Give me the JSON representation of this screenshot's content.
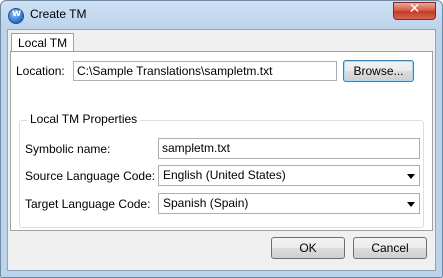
{
  "window": {
    "title": "Create TM",
    "close_glyph": "✕"
  },
  "tab": {
    "label": "Local TM"
  },
  "location": {
    "label": "Location:",
    "value": "C:\\Sample Translations\\sampletm.txt",
    "browse_label": "Browse..."
  },
  "properties": {
    "group_title": "Local TM Properties",
    "symbolic_name": {
      "label": "Symbolic name:",
      "value": "sampletm.txt"
    },
    "source_language": {
      "label": "Source Language Code:",
      "value": "English (United States)"
    },
    "target_language": {
      "label": "Target Language Code:",
      "value": "Spanish (Spain)"
    }
  },
  "footer": {
    "ok_label": "OK",
    "cancel_label": "Cancel"
  },
  "icons": {
    "app": "app-icon",
    "close": "close-icon",
    "dropdown": "chevron-down-icon"
  },
  "colors": {
    "title_bar": "#bcd3ec",
    "close_button": "#d7513d",
    "dialog_bg": "#f0f0f0"
  }
}
